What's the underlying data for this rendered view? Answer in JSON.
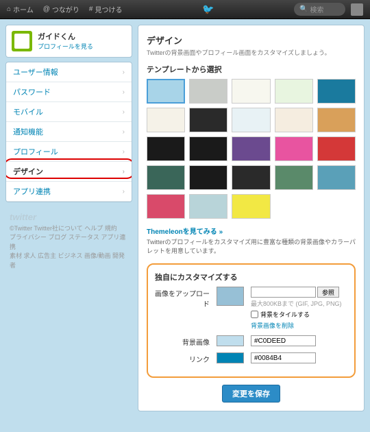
{
  "topbar": {
    "home": "ホーム",
    "connect": "つながり",
    "discover": "見つける",
    "search": "検索"
  },
  "profile": {
    "name": "ガイドくん",
    "view": "プロフィールを見る"
  },
  "menu": [
    "ユーザー情報",
    "パスワード",
    "モバイル",
    "通知機能",
    "プロフィール",
    "デザイン",
    "アプリ連携"
  ],
  "footer": {
    "logo": "twitter",
    "line1": "©Twitter Twitter社について ヘルプ 規約",
    "line2": "プライバシー ブログ ステータス アプリ連携",
    "line3": "素材 求人 広告主 ビジネス 画像/動画 開発者"
  },
  "design": {
    "title": "デザイン",
    "subtitle": "Twitterの背景画面やプロフィール画面をカスタマイズしましょう。",
    "template_heading": "テンプレートから選択",
    "themeleon": "Themeleonを見てみる »",
    "themeleon_sub": "Twitterのプロフィールをカスタマイズ用に豊富な種類の背景画像やカラーパレットを用意しています。",
    "customize_heading": "独自にカスタマイズする",
    "upload_label": "画像をアップロード",
    "browse_btn": "参照",
    "upload_hint": "最大800KBまで (GIF, JPG, PNG)",
    "tile_bg": "背景をタイルする",
    "delete_bg": "背景画像を削除",
    "bg_label": "背景画像",
    "bg_color": "#C0DEED",
    "link_label": "リンク",
    "link_color": "#0084B4",
    "save": "変更を保存"
  },
  "templates": [
    {
      "bg": "#a8d4e8"
    },
    {
      "bg": "#c9ccc8"
    },
    {
      "bg": "#f7f7ef"
    },
    {
      "bg": "#e8f5e0"
    },
    {
      "bg": "#1a7a9e"
    },
    {
      "bg": "#f5f2e8"
    },
    {
      "bg": "#2a2a2a"
    },
    {
      "bg": "#e8f2f5"
    },
    {
      "bg": "#f5ede0"
    },
    {
      "bg": "#d9a05a"
    },
    {
      "bg": "#1a1a1a"
    },
    {
      "bg": "#1a1a1a"
    },
    {
      "bg": "#6b4a8f"
    },
    {
      "bg": "#e854a0"
    },
    {
      "bg": "#d43838"
    },
    {
      "bg": "#3a6659"
    },
    {
      "bg": "#1a1a1a"
    },
    {
      "bg": "#2a2a2a"
    },
    {
      "bg": "#5a8a6a"
    },
    {
      "bg": "#5aa0b8"
    },
    {
      "bg": "#d94a6a"
    },
    {
      "bg": "#b8d4d9"
    },
    {
      "bg": "#f2e844"
    }
  ]
}
